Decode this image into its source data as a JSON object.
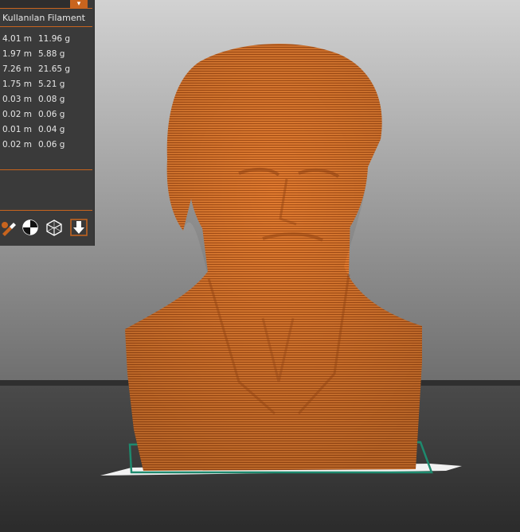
{
  "panel": {
    "header": "Kullanılan Filament",
    "dropdown_arrow": "▾",
    "rows": [
      {
        "length": "4.01 m",
        "weight": "11.96 g"
      },
      {
        "length": "1.97 m",
        "weight": "5.88 g"
      },
      {
        "length": "7.26 m",
        "weight": "21.65 g"
      },
      {
        "length": "1.75 m",
        "weight": "5.21 g"
      },
      {
        "length": "0.03 m",
        "weight": "0.08 g"
      },
      {
        "length": "0.02 m",
        "weight": "0.06 g"
      },
      {
        "length": "0.01 m",
        "weight": "0.04 g"
      },
      {
        "length": "0.02 m",
        "weight": "0.06 g"
      }
    ],
    "tools": [
      "paint-icon",
      "contrast-icon",
      "cube-wireframe-icon",
      "download-icon"
    ]
  },
  "colors": {
    "accent": "#c8641e",
    "model": "#e07b30",
    "panel_bg": "#3a3a3a",
    "bed": "#3a3a3a",
    "bed_outline": "#1e8a6e"
  }
}
